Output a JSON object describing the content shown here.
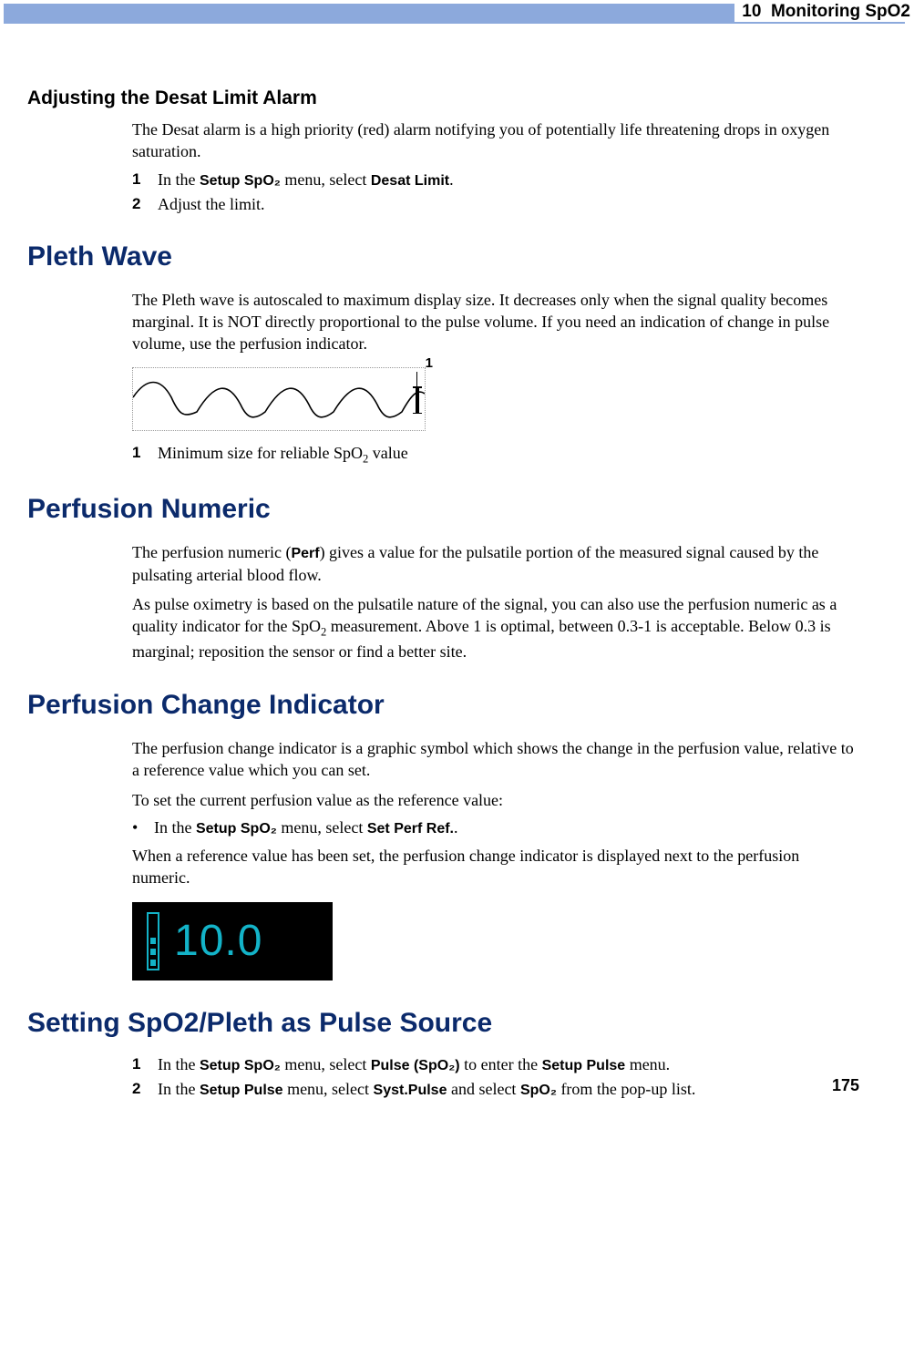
{
  "header": {
    "chapter": "10",
    "title": "Monitoring SpO2"
  },
  "sections": {
    "desat": {
      "heading": "Adjusting the Desat Limit Alarm",
      "intro": "The Desat alarm is a high priority (red) alarm notifying you of potentially life threatening drops in oxygen saturation.",
      "steps": {
        "s1": {
          "num": "1",
          "pre": "In the ",
          "ui1": "Setup SpO₂",
          "mid": " menu, select ",
          "ui2": "Desat Limit",
          "post": "."
        },
        "s2": {
          "num": "2",
          "text": "Adjust the limit."
        }
      }
    },
    "pleth": {
      "heading": "Pleth Wave",
      "intro": "The Pleth wave is autoscaled to maximum display size. It decreases only when the signal quality becomes marginal. It is NOT directly proportional to the pulse volume. If you need an indication of change in pulse volume, use the perfusion indicator.",
      "wave_label": "1",
      "legend": {
        "num": "1",
        "pre": "Minimum size for reliable SpO",
        "sub": "2",
        "post": " value"
      }
    },
    "perfnum": {
      "heading": "Perfusion Numeric",
      "p1_pre": "The perfusion numeric (",
      "p1_ui": "Perf",
      "p1_post": ") gives a value for the pulsatile portion of the measured signal caused by the pulsating arterial blood flow.",
      "p2_pre": "As pulse oximetry is based on the pulsatile nature of the signal, you can also use the perfusion numeric as a quality indicator for the SpO",
      "p2_sub": "2",
      "p2_post": " measurement. Above 1 is optimal, between 0.3-1 is acceptable. Below 0.3 is marginal; reposition the sensor or find a better site."
    },
    "perfchg": {
      "heading": "Perfusion Change Indicator",
      "intro": "The perfusion change indicator is a graphic symbol which shows the change in the perfusion value, relative to a reference value which you can set.",
      "line2": "To set the current perfusion value as the reference value:",
      "bullet": {
        "pre": "In the ",
        "ui1": "Setup SpO₂",
        "mid": " menu, select ",
        "ui2": "Set Perf Ref.",
        "post": "."
      },
      "line3": "When a reference value has been set, the perfusion change indicator is displayed next to the perfusion numeric.",
      "perf_value": "10.0"
    },
    "pulsesrc": {
      "heading": "Setting SpO2/Pleth as Pulse Source",
      "s1": {
        "num": "1",
        "pre": "In the ",
        "ui1": "Setup SpO₂",
        "mid1": " menu, select ",
        "ui2": "Pulse (SpO₂)",
        "mid2": " to enter the ",
        "ui3": "Setup Pulse",
        "post": " menu."
      },
      "s2": {
        "num": "2",
        "pre": "In the ",
        "ui1": "Setup Pulse",
        "mid1": " menu, select ",
        "ui2": "Syst.Pulse",
        "mid2": " and select ",
        "ui3": "SpO₂",
        "post": " from the pop-up list."
      }
    }
  },
  "page_number": "175"
}
